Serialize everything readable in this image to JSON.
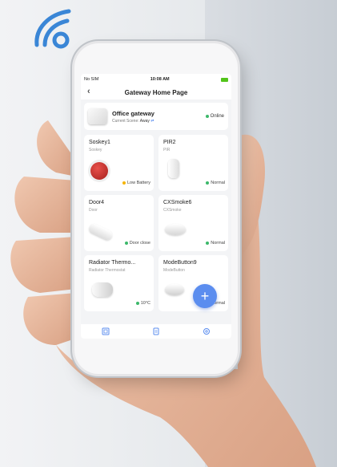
{
  "status_bar": {
    "carrier": "No SIM",
    "time": "10:08 AM"
  },
  "header": {
    "title": "Gateway Home Page"
  },
  "gateway": {
    "name": "Office gateway",
    "scene_label": "Current Scene:",
    "scene_value": "Away",
    "status": "Online"
  },
  "devices": [
    {
      "name": "Soskey1",
      "type": "Soskey",
      "status": "Low Battery",
      "status_color": "#f5b400"
    },
    {
      "name": "PIR2",
      "type": "PIR",
      "status": "Normal",
      "status_color": "#3cb86a"
    },
    {
      "name": "Door4",
      "type": "Door",
      "status": "Door close",
      "status_color": "#3cb86a"
    },
    {
      "name": "CXSmoke6",
      "type": "CXSmoke",
      "status": "Normal",
      "status_color": "#3cb86a"
    },
    {
      "name": "Radiator Thermo...",
      "type": "Radiator Thermostat",
      "status": "10°C",
      "status_color": "#3cb86a"
    },
    {
      "name": "ModeButton9",
      "type": "ModeButton",
      "status": "Normal",
      "status_color": "#3cb86a"
    }
  ],
  "fab": {
    "label": "+"
  },
  "colors": {
    "accent": "#5b8def",
    "online": "#3cb86a",
    "warning": "#f5b400",
    "signal_icon": "#3a86d6"
  }
}
